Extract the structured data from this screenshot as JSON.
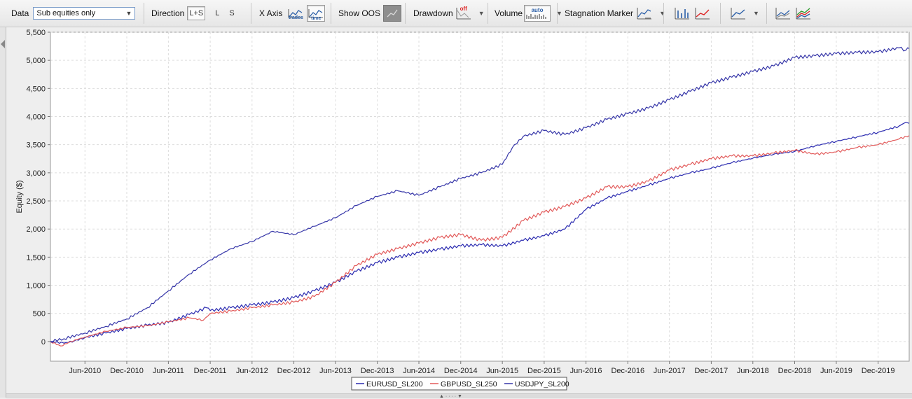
{
  "toolbar": {
    "data_label": "Data",
    "data_select_value": "Sub equities only",
    "direction_label": "Direction",
    "dir_ls": "L+S",
    "dir_l": "L",
    "dir_s": "S",
    "xaxis_label": "X Axis",
    "xaxis_trades": "trades",
    "xaxis_time": "time",
    "show_oos_label": "Show OOS",
    "drawdown_label": "Drawdown",
    "drawdown_state": "off",
    "volume_label": "Volume",
    "volume_state": "auto",
    "stagnation_label": "Stagnation Marker"
  },
  "colors": {
    "eurusd": "#2b2bb0",
    "gbpusd": "#e25a5a",
    "usdjpy": "#3636a8"
  },
  "chart_data": {
    "type": "line",
    "ylabel": "Equity ($)",
    "xlabel": "",
    "ylim": [
      -350,
      5500
    ],
    "yticks": [
      0,
      500,
      1000,
      1500,
      2000,
      2500,
      3000,
      3500,
      4000,
      4500,
      5000,
      5500
    ],
    "ytick_labels": [
      "0",
      "500",
      "1,000",
      "1,500",
      "2,000",
      "2,500",
      "3,000",
      "3,500",
      "4,000",
      "4,500",
      "5,000",
      "5,500"
    ],
    "xlim": [
      "2010-01-01",
      "2020-04-15"
    ],
    "xticks": [
      "2010-06-01",
      "2010-12-01",
      "2011-06-01",
      "2011-12-01",
      "2012-06-01",
      "2012-12-01",
      "2013-06-01",
      "2013-12-01",
      "2014-06-01",
      "2014-12-01",
      "2015-06-01",
      "2015-12-01",
      "2016-06-01",
      "2016-12-01",
      "2017-06-01",
      "2017-12-01",
      "2018-06-01",
      "2018-12-01",
      "2019-06-01",
      "2019-12-01"
    ],
    "xtick_labels": [
      "Jun-2010",
      "Dec-2010",
      "Jun-2011",
      "Dec-2011",
      "Jun-2012",
      "Dec-2012",
      "Jun-2013",
      "Dec-2013",
      "Jun-2014",
      "Dec-2014",
      "Jun-2015",
      "Dec-2015",
      "Jun-2016",
      "Dec-2016",
      "Jun-2017",
      "Dec-2017",
      "Jun-2018",
      "Dec-2018",
      "Jun-2019",
      "Dec-2019"
    ],
    "grid": true,
    "legend_position": "bottom-center",
    "series": [
      {
        "name": "EURUSD_SL200",
        "color_key": "eurusd",
        "points": [
          [
            "2010-01-01",
            0
          ],
          [
            "2010-03-01",
            -30
          ],
          [
            "2010-04-15",
            10
          ],
          [
            "2010-06-01",
            70
          ],
          [
            "2010-09-01",
            150
          ],
          [
            "2010-12-01",
            230
          ],
          [
            "2011-03-01",
            290
          ],
          [
            "2011-06-01",
            340
          ],
          [
            "2011-09-01",
            480
          ],
          [
            "2011-11-15",
            600
          ],
          [
            "2011-12-01",
            550
          ],
          [
            "2012-03-01",
            600
          ],
          [
            "2012-06-01",
            650
          ],
          [
            "2012-09-01",
            700
          ],
          [
            "2012-12-01",
            780
          ],
          [
            "2013-03-01",
            900
          ],
          [
            "2013-06-01",
            1050
          ],
          [
            "2013-09-01",
            1250
          ],
          [
            "2013-12-01",
            1400
          ],
          [
            "2014-03-01",
            1500
          ],
          [
            "2014-06-01",
            1580
          ],
          [
            "2014-09-01",
            1640
          ],
          [
            "2014-12-01",
            1700
          ],
          [
            "2015-03-01",
            1720
          ],
          [
            "2015-06-01",
            1700
          ],
          [
            "2015-09-01",
            1800
          ],
          [
            "2015-12-01",
            1880
          ],
          [
            "2016-03-01",
            2000
          ],
          [
            "2016-06-01",
            2350
          ],
          [
            "2016-09-01",
            2550
          ],
          [
            "2016-12-01",
            2670
          ],
          [
            "2017-03-01",
            2780
          ],
          [
            "2017-06-01",
            2900
          ],
          [
            "2017-09-01",
            3000
          ],
          [
            "2017-12-01",
            3080
          ],
          [
            "2018-03-01",
            3180
          ],
          [
            "2018-06-01",
            3260
          ],
          [
            "2018-09-01",
            3330
          ],
          [
            "2018-12-01",
            3380
          ],
          [
            "2019-03-01",
            3480
          ],
          [
            "2019-06-01",
            3560
          ],
          [
            "2019-09-01",
            3640
          ],
          [
            "2019-12-01",
            3720
          ],
          [
            "2020-03-01",
            3830
          ],
          [
            "2020-04-01",
            3900
          ],
          [
            "2020-04-15",
            3880
          ]
        ]
      },
      {
        "name": "GBPUSD_SL250",
        "color_key": "gbpusd",
        "points": [
          [
            "2010-01-01",
            0
          ],
          [
            "2010-02-15",
            -80
          ],
          [
            "2010-04-01",
            0
          ],
          [
            "2010-06-01",
            80
          ],
          [
            "2010-09-01",
            180
          ],
          [
            "2010-12-01",
            250
          ],
          [
            "2011-03-01",
            280
          ],
          [
            "2011-06-01",
            350
          ],
          [
            "2011-09-01",
            420
          ],
          [
            "2011-11-01",
            380
          ],
          [
            "2011-12-01",
            500
          ],
          [
            "2012-03-01",
            540
          ],
          [
            "2012-06-01",
            600
          ],
          [
            "2012-09-01",
            650
          ],
          [
            "2012-12-01",
            700
          ],
          [
            "2013-03-01",
            800
          ],
          [
            "2013-06-01",
            1050
          ],
          [
            "2013-09-01",
            1350
          ],
          [
            "2013-12-01",
            1550
          ],
          [
            "2014-03-01",
            1650
          ],
          [
            "2014-06-01",
            1750
          ],
          [
            "2014-09-01",
            1850
          ],
          [
            "2014-12-01",
            1900
          ],
          [
            "2015-03-01",
            1800
          ],
          [
            "2015-06-01",
            1850
          ],
          [
            "2015-09-01",
            2150
          ],
          [
            "2015-12-01",
            2300
          ],
          [
            "2016-03-01",
            2400
          ],
          [
            "2016-06-01",
            2550
          ],
          [
            "2016-09-01",
            2750
          ],
          [
            "2016-12-01",
            2750
          ],
          [
            "2017-03-01",
            2850
          ],
          [
            "2017-06-01",
            3050
          ],
          [
            "2017-09-01",
            3150
          ],
          [
            "2017-12-01",
            3250
          ],
          [
            "2018-03-01",
            3300
          ],
          [
            "2018-06-01",
            3300
          ],
          [
            "2018-09-01",
            3350
          ],
          [
            "2018-12-01",
            3400
          ],
          [
            "2019-03-01",
            3330
          ],
          [
            "2019-06-01",
            3370
          ],
          [
            "2019-09-01",
            3450
          ],
          [
            "2019-12-01",
            3500
          ],
          [
            "2020-03-01",
            3600
          ],
          [
            "2020-04-15",
            3660
          ]
        ]
      },
      {
        "name": "USDJPY_SL200",
        "color_key": "usdjpy",
        "points": [
          [
            "2010-01-01",
            0
          ],
          [
            "2010-03-01",
            50
          ],
          [
            "2010-06-01",
            150
          ],
          [
            "2010-09-01",
            270
          ],
          [
            "2010-12-01",
            400
          ],
          [
            "2011-03-01",
            600
          ],
          [
            "2011-06-01",
            900
          ],
          [
            "2011-09-01",
            1200
          ],
          [
            "2011-12-01",
            1450
          ],
          [
            "2012-03-01",
            1650
          ],
          [
            "2012-06-01",
            1780
          ],
          [
            "2012-09-01",
            1960
          ],
          [
            "2012-12-01",
            1900
          ],
          [
            "2013-03-01",
            2050
          ],
          [
            "2013-06-01",
            2200
          ],
          [
            "2013-09-01",
            2420
          ],
          [
            "2013-12-01",
            2580
          ],
          [
            "2014-03-01",
            2680
          ],
          [
            "2014-06-01",
            2600
          ],
          [
            "2014-09-01",
            2750
          ],
          [
            "2014-12-01",
            2900
          ],
          [
            "2015-03-01",
            3000
          ],
          [
            "2015-06-01",
            3150
          ],
          [
            "2015-07-15",
            3450
          ],
          [
            "2015-09-01",
            3650
          ],
          [
            "2015-12-01",
            3750
          ],
          [
            "2016-03-01",
            3680
          ],
          [
            "2016-06-01",
            3800
          ],
          [
            "2016-09-01",
            3950
          ],
          [
            "2016-12-01",
            4050
          ],
          [
            "2017-03-01",
            4150
          ],
          [
            "2017-06-01",
            4300
          ],
          [
            "2017-09-01",
            4450
          ],
          [
            "2017-12-01",
            4600
          ],
          [
            "2018-03-01",
            4700
          ],
          [
            "2018-06-01",
            4800
          ],
          [
            "2018-09-01",
            4900
          ],
          [
            "2018-12-01",
            5050
          ],
          [
            "2019-03-01",
            5080
          ],
          [
            "2019-06-01",
            5120
          ],
          [
            "2019-09-01",
            5140
          ],
          [
            "2019-12-01",
            5150
          ],
          [
            "2020-03-01",
            5220
          ],
          [
            "2020-04-01",
            5180
          ],
          [
            "2020-04-15",
            5210
          ]
        ]
      }
    ]
  }
}
